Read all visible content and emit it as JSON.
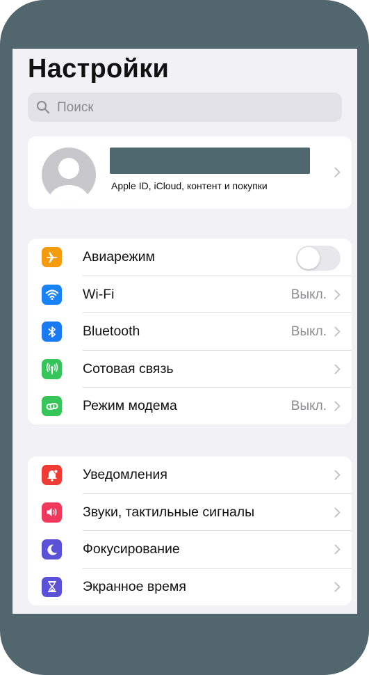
{
  "header": {
    "title": "Настройки"
  },
  "search": {
    "placeholder": "Поиск"
  },
  "profile": {
    "subtitle": "Apple ID, iCloud, контент и покупки"
  },
  "network_group": [
    {
      "label": "Авиарежим",
      "icon": "airplane-icon",
      "color": "#f59b0e",
      "toggle": false,
      "value": ""
    },
    {
      "label": "Wi-Fi",
      "icon": "wifi-icon",
      "color": "#1a82f7",
      "value": "Выкл."
    },
    {
      "label": "Bluetooth",
      "icon": "bluetooth-icon",
      "color": "#1a7af3",
      "value": "Выкл."
    },
    {
      "label": "Сотовая связь",
      "icon": "antenna-icon",
      "color": "#35c559",
      "value": ""
    },
    {
      "label": "Режим модема",
      "icon": "link-icon",
      "color": "#35c559",
      "value": "Выкл."
    }
  ],
  "notify_group": [
    {
      "label": "Уведомления",
      "icon": "bell-icon",
      "color": "#ef3b33"
    },
    {
      "label": "Звуки, тактильные сигналы",
      "icon": "speaker-icon",
      "color": "#ef3a5d"
    },
    {
      "label": "Фокусирование",
      "icon": "moon-icon",
      "color": "#5a51d6"
    },
    {
      "label": "Экранное время",
      "icon": "hourglass-icon",
      "color": "#5a51d6"
    }
  ]
}
